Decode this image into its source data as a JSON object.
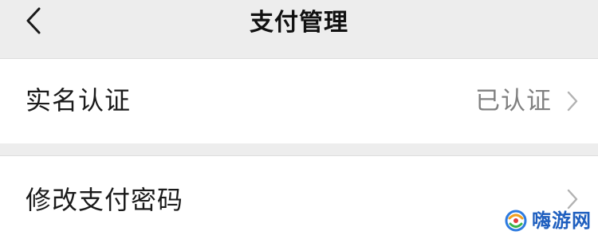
{
  "header": {
    "title": "支付管理",
    "back_icon": "chevron-left-icon"
  },
  "rows": [
    {
      "label": "实名认证",
      "value": "已认证",
      "icon": "chevron-right-icon"
    },
    {
      "label": "修改支付密码",
      "value": "",
      "icon": "chevron-right-icon"
    }
  ],
  "watermark": {
    "text": "嗨游网",
    "logo_icon": "swirl-logo-icon",
    "color": "#1f5fbf"
  },
  "colors": {
    "background": "#ededed",
    "row_background": "#ffffff",
    "value_text": "#808080",
    "chevron": "#b2b2b2"
  }
}
